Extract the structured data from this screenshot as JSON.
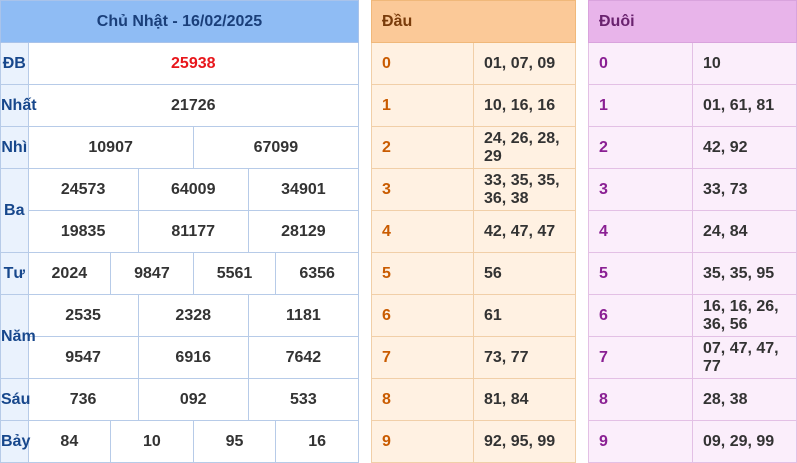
{
  "results": {
    "title": "Chủ Nhật - 16/02/2025",
    "prizes": [
      {
        "label": "ĐB",
        "rows": [
          [
            "25938"
          ]
        ],
        "special": true
      },
      {
        "label": "Nhất",
        "rows": [
          [
            "21726"
          ]
        ]
      },
      {
        "label": "Nhì",
        "rows": [
          [
            "10907",
            "67099"
          ]
        ]
      },
      {
        "label": "Ba",
        "rows": [
          [
            "24573",
            "64009",
            "34901"
          ],
          [
            "19835",
            "81177",
            "28129"
          ]
        ]
      },
      {
        "label": "Tư",
        "rows": [
          [
            "2024",
            "9847",
            "5561",
            "6356"
          ]
        ]
      },
      {
        "label": "Năm",
        "rows": [
          [
            "2535",
            "2328",
            "1181"
          ],
          [
            "9547",
            "6916",
            "7642"
          ]
        ]
      },
      {
        "label": "Sáu",
        "rows": [
          [
            "736",
            "092",
            "533"
          ]
        ]
      },
      {
        "label": "Bảy",
        "rows": [
          [
            "84",
            "10",
            "95",
            "16"
          ]
        ]
      }
    ]
  },
  "dau": {
    "header": "Đầu",
    "rows": [
      {
        "num": "0",
        "values": "01, 07, 09"
      },
      {
        "num": "1",
        "values": "10, 16, 16"
      },
      {
        "num": "2",
        "values": "24, 26, 28, 29"
      },
      {
        "num": "3",
        "values": "33, 35, 35, 36, 38"
      },
      {
        "num": "4",
        "values": "42, 47, 47"
      },
      {
        "num": "5",
        "values": "56"
      },
      {
        "num": "6",
        "values": "61"
      },
      {
        "num": "7",
        "values": "73, 77"
      },
      {
        "num": "8",
        "values": "81, 84"
      },
      {
        "num": "9",
        "values": "92, 95, 99"
      }
    ]
  },
  "duoi": {
    "header": "Đuôi",
    "rows": [
      {
        "num": "0",
        "values": "10"
      },
      {
        "num": "1",
        "values": "01, 61, 81"
      },
      {
        "num": "2",
        "values": "42, 92"
      },
      {
        "num": "3",
        "values": "33, 73"
      },
      {
        "num": "4",
        "values": "24, 84"
      },
      {
        "num": "5",
        "values": "35, 35, 95"
      },
      {
        "num": "6",
        "values": "16, 16, 26, 36, 56"
      },
      {
        "num": "7",
        "values": "07, 47, 47, 77"
      },
      {
        "num": "8",
        "values": "28, 38"
      },
      {
        "num": "9",
        "values": "09, 29, 99"
      }
    ]
  }
}
